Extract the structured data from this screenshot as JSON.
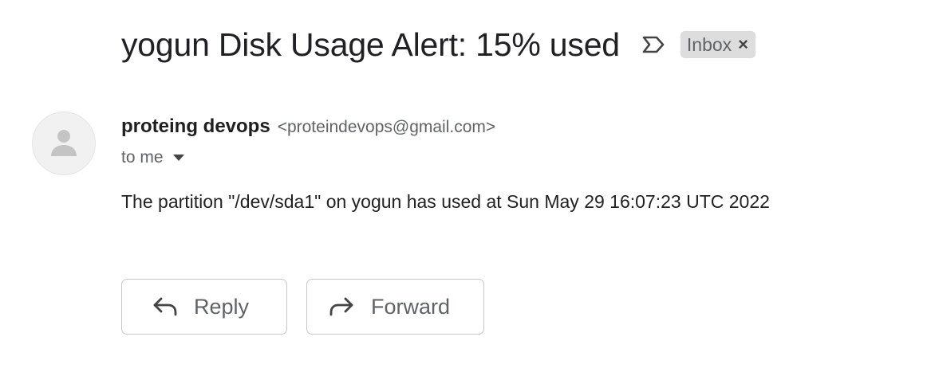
{
  "message": {
    "subject": "yogun Disk Usage Alert: 15% used",
    "label": "Inbox",
    "label_close": "×",
    "sender": {
      "name": "proteing devops",
      "email": "<proteindevops@gmail.com>"
    },
    "recipient": "to me",
    "body": "The partition \"/dev/sda1\" on yogun has used at Sun May 29 16:07:23 UTC 2022"
  },
  "actions": {
    "reply_label": "Reply",
    "forward_label": "Forward"
  },
  "icons": {
    "important": "important-marker-icon",
    "avatar": "person-icon",
    "caret": "caret-down-icon",
    "reply": "reply-arrow-icon",
    "forward": "forward-arrow-icon"
  },
  "colors": {
    "label_chip_bg": "#dddddd",
    "secondary_text": "#5f6368",
    "button_border": "#c8c8c8"
  }
}
